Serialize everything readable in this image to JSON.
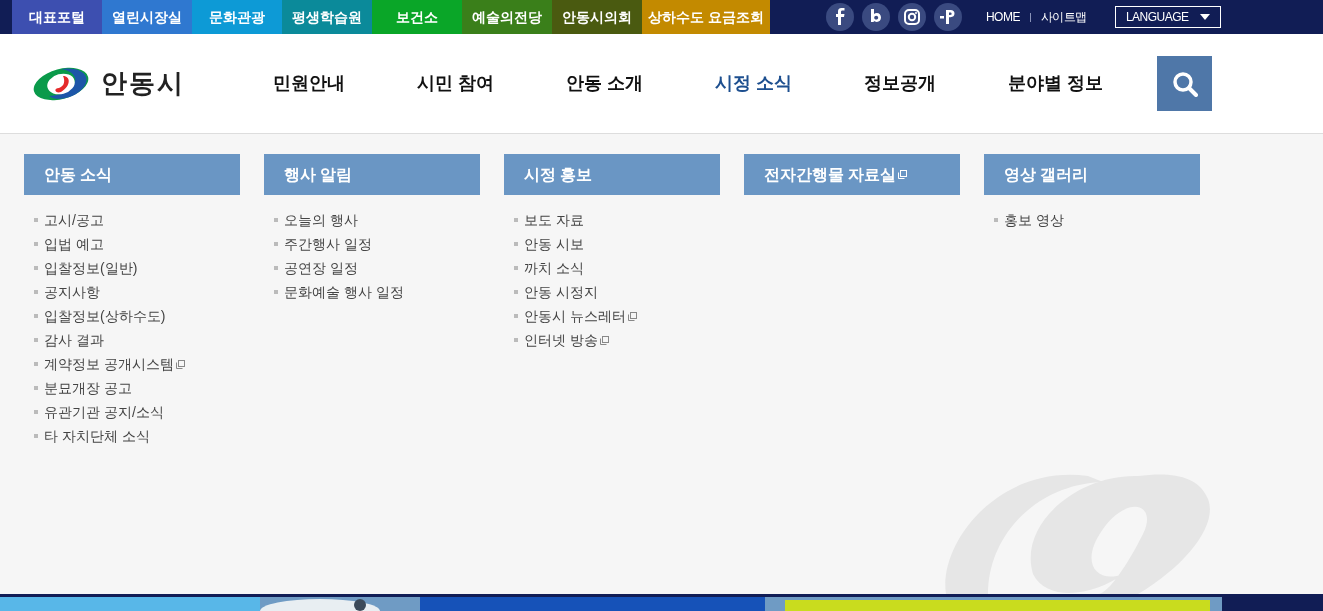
{
  "top_links": [
    {
      "label": "대표포털",
      "color": "#3d4fb0"
    },
    {
      "label": "열린시장실",
      "color": "#2f78d0"
    },
    {
      "label": "문화관광",
      "color": "#0d9ad6"
    },
    {
      "label": "평생학습원",
      "color": "#0b8a9a"
    },
    {
      "label": "보건소",
      "color": "#0aa628"
    },
    {
      "label": "예술의전당",
      "color": "#3a7f1a"
    },
    {
      "label": "안동시의회",
      "color": "#4a5a10"
    },
    {
      "label": "상하수도 요금조회",
      "color": "#c38a00"
    }
  ],
  "sns": [
    {
      "kind": "facebook"
    },
    {
      "kind": "blog"
    },
    {
      "kind": "instagram"
    },
    {
      "kind": "post"
    }
  ],
  "utility_links": [
    "HOME",
    "사이트맵"
  ],
  "language": {
    "label": "LANGUAGE"
  },
  "logo": {
    "text": "안동시"
  },
  "nav": [
    {
      "label": "민원안내",
      "selected": false
    },
    {
      "label": "시민 참여",
      "selected": false
    },
    {
      "label": "안동 소개",
      "selected": false
    },
    {
      "label": "시정 소식",
      "selected": true
    },
    {
      "label": "정보공개",
      "selected": false
    },
    {
      "label": "분야별 정보",
      "selected": false
    }
  ],
  "menu": [
    {
      "title": "안동 소식",
      "external": false,
      "items": [
        {
          "label": "고시/공고",
          "external": false
        },
        {
          "label": "입법 예고",
          "external": false
        },
        {
          "label": "입찰정보(일반)",
          "external": false
        },
        {
          "label": "공지사항",
          "external": false
        },
        {
          "label": "입찰정보(상하수도)",
          "external": false
        },
        {
          "label": "감사 결과",
          "external": false
        },
        {
          "label": "계약정보 공개시스템",
          "external": true
        },
        {
          "label": "분묘개장 공고",
          "external": false
        },
        {
          "label": "유관기관 공지/소식",
          "external": false
        },
        {
          "label": "타 자치단체 소식",
          "external": false
        }
      ]
    },
    {
      "title": "행사 알림",
      "external": false,
      "items": [
        {
          "label": "오늘의 행사",
          "external": false
        },
        {
          "label": "주간행사 일정",
          "external": false
        },
        {
          "label": "공연장 일정",
          "external": false
        },
        {
          "label": "문화예술 행사 일정",
          "external": false
        }
      ]
    },
    {
      "title": "시정 홍보",
      "external": false,
      "items": [
        {
          "label": "보도 자료",
          "external": false
        },
        {
          "label": "안동 시보",
          "external": false
        },
        {
          "label": "까치 소식",
          "external": false
        },
        {
          "label": "안동 시정지",
          "external": false
        },
        {
          "label": "안동시 뉴스레터",
          "external": true
        },
        {
          "label": "인터넷 방송",
          "external": true
        }
      ]
    },
    {
      "title": "전자간행물 자료실",
      "external": true
    },
    {
      "title": "영상 갤러리",
      "external": false,
      "items": [
        {
          "label": "홍보 영상",
          "external": false
        }
      ]
    }
  ]
}
